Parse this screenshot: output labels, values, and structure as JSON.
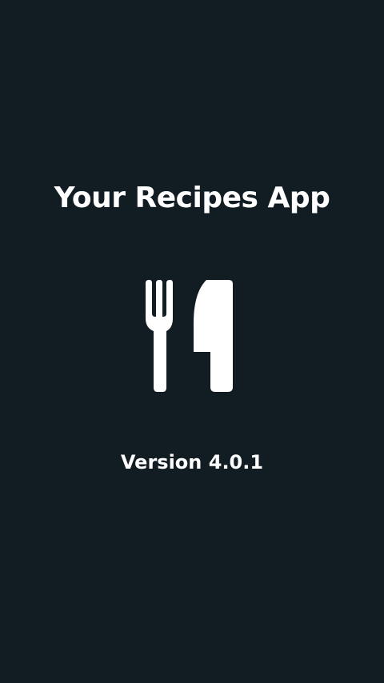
{
  "splash": {
    "title": "Your Recipes App",
    "logo_icon": "fork-and-knife-icon",
    "version": "Version 4.0.1"
  },
  "colors": {
    "background": "#121c23",
    "foreground": "#ffffff"
  }
}
